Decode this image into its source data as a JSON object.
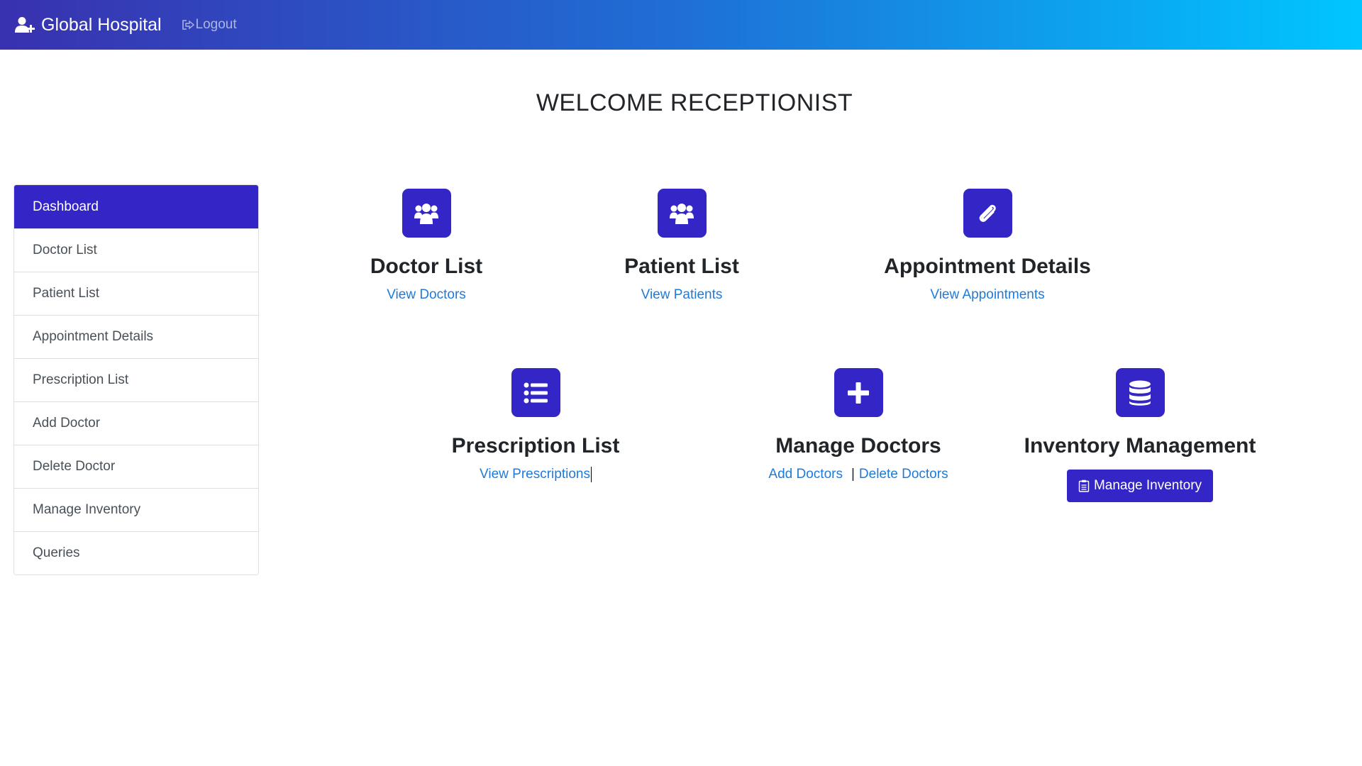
{
  "navbar": {
    "brand": "Global Hospital",
    "brand_icon": "user-plus-icon",
    "logout": "Logout",
    "logout_icon": "sign-out-icon"
  },
  "page": {
    "welcome": "WELCOME RECEPTIONIST"
  },
  "sidebar": {
    "items": [
      {
        "label": "Dashboard",
        "active": true
      },
      {
        "label": "Doctor List"
      },
      {
        "label": "Patient List"
      },
      {
        "label": "Appointment Details"
      },
      {
        "label": "Prescription List"
      },
      {
        "label": "Add Doctor"
      },
      {
        "label": "Delete Doctor"
      },
      {
        "label": "Manage Inventory"
      },
      {
        "label": "Queries"
      }
    ]
  },
  "cards": {
    "doctor_list": {
      "title": "Doctor List",
      "link": "View Doctors",
      "icon": "users-icon"
    },
    "patient_list": {
      "title": "Patient List",
      "link": "View Patients",
      "icon": "users-icon"
    },
    "appointments": {
      "title": "Appointment Details",
      "link": "View Appointments",
      "icon": "paperclip-icon"
    },
    "prescriptions": {
      "title": "Prescription List",
      "link": "View Prescriptions",
      "icon": "list-icon"
    },
    "manage_doctors": {
      "title": "Manage Doctors",
      "link_add": "Add Doctors",
      "separator": "|",
      "link_delete": "Delete Doctors",
      "icon": "plus-square-icon"
    },
    "inventory": {
      "title": "Inventory Management",
      "button": "Manage Inventory",
      "icon": "database-icon",
      "button_icon": "clipboard-icon"
    }
  },
  "colors": {
    "accent": "#3425c6",
    "link": "#1f7ad8",
    "nav_start": "#3931af",
    "nav_end": "#00c6ff"
  }
}
